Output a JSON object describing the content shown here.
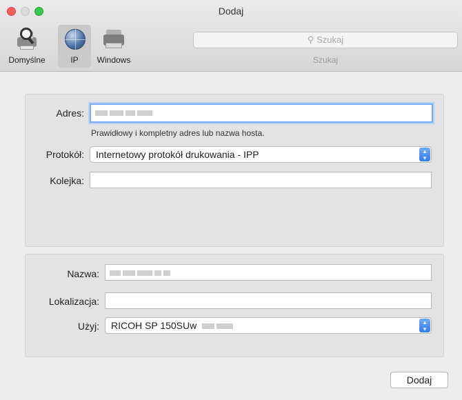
{
  "window": {
    "title": "Dodaj"
  },
  "toolbar": {
    "items": [
      {
        "label": "Domyślne",
        "icon": "default-printer-icon"
      },
      {
        "label": "IP",
        "icon": "globe-icon",
        "selected": true
      },
      {
        "label": "Windows",
        "icon": "windows-printer-icon"
      }
    ],
    "search": {
      "placeholder": "Szukaj",
      "caption": "Szukaj"
    }
  },
  "form": {
    "address": {
      "label": "Adres:",
      "value": "",
      "hint": "Prawidłowy i kompletny adres lub nazwa hosta."
    },
    "protocol": {
      "label": "Protokół:",
      "value": "Internetowy protokół drukowania - IPP"
    },
    "queue": {
      "label": "Kolejka:",
      "value": ""
    },
    "name": {
      "label": "Nazwa:",
      "value": ""
    },
    "location": {
      "label": "Lokalizacja:",
      "value": ""
    },
    "use": {
      "label": "Użyj:",
      "value": "RICOH SP 150SUw"
    }
  },
  "actions": {
    "add_label": "Dodaj"
  },
  "colors": {
    "accent": "#2f7cf2",
    "focus_ring": "#7aacf3"
  }
}
